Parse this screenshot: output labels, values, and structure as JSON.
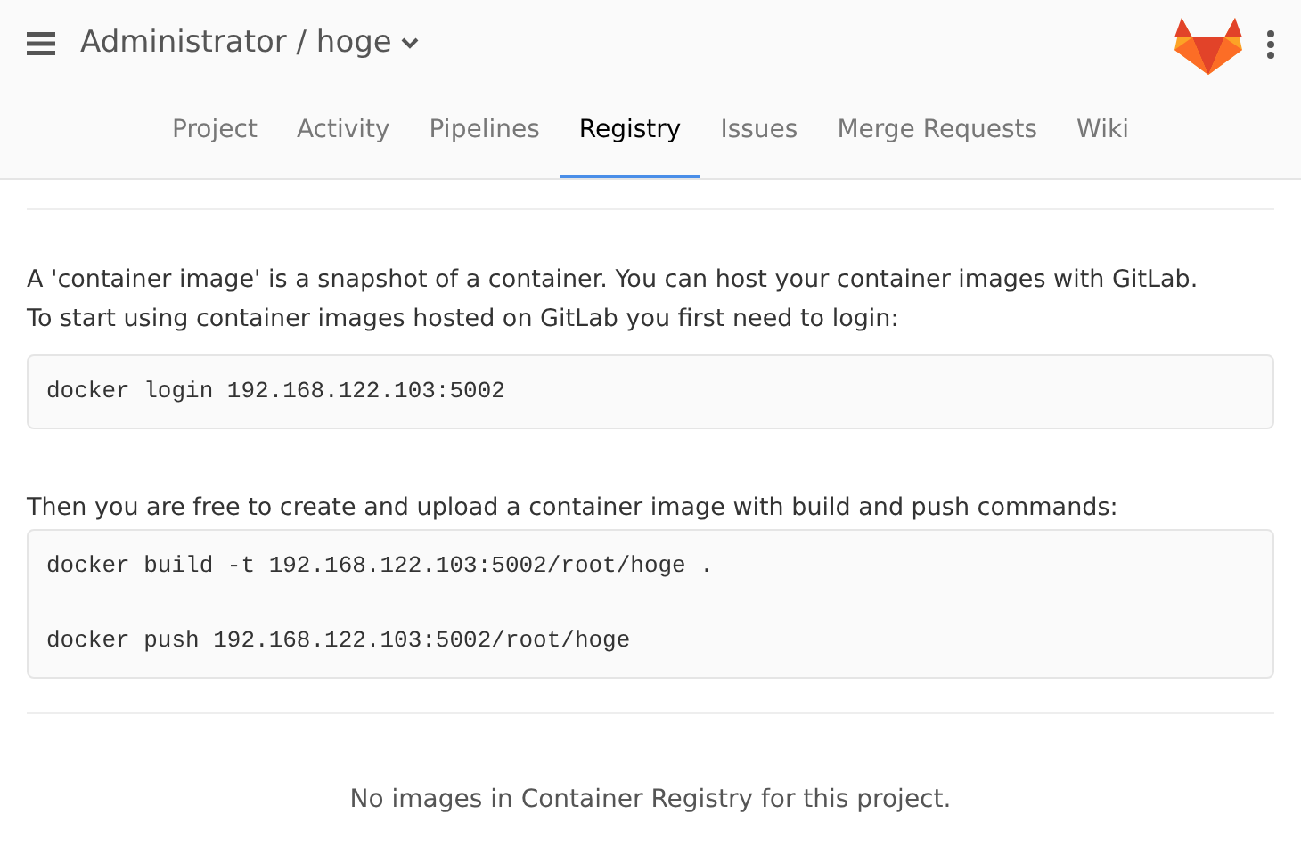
{
  "header": {
    "breadcrumb": "Administrator / hoge"
  },
  "tabs": [
    {
      "label": "Project",
      "selected": false
    },
    {
      "label": "Activity",
      "selected": false
    },
    {
      "label": "Pipelines",
      "selected": false
    },
    {
      "label": "Registry",
      "selected": true
    },
    {
      "label": "Issues",
      "selected": false
    },
    {
      "label": "Merge Requests",
      "selected": false
    },
    {
      "label": "Wiki",
      "selected": false
    }
  ],
  "intro": [
    "A 'container image' is a snapshot of a container. You can host your container images with GitLab.",
    "To start using container images hosted on GitLab you first need to login:"
  ],
  "login_commands": [
    "docker login 192.168.122.103:5002"
  ],
  "push_text": "Then you are free to create and upload a container image with build and push commands:",
  "push_commands": [
    "docker build -t 192.168.122.103:5002/root/hoge .",
    "docker push 192.168.122.103:5002/root/hoge"
  ],
  "empty_message": "No images in Container Registry for this project."
}
